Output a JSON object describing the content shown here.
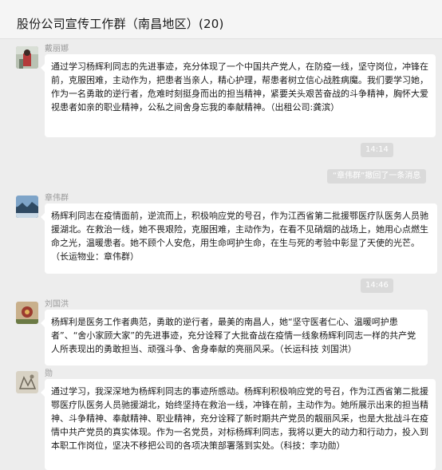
{
  "chat": {
    "title": "股份公司宣传工作群（南昌地区）(20)"
  },
  "messages": [
    {
      "sender": "戴丽娜",
      "avatar_icon": "avatar-photo-icon",
      "text": "通过学习杨辉利同志的先进事迹，充分体现了一个中国共产党人，在防疫一线，坚守岗位，冲锋在前，克服困难，主动作为，把患者当亲人，精心护理，帮患者树立信心战胜病魔。我们要学习她，作为一名勇敢的逆行者，危难时刻挺身而出的担当精神，紧要关头艰苦奋战的斗争精神，胸怀大爱视患者如亲的职业精神，公私之间舍身忘我的奉献精神。（出租公司:龚滨）"
    },
    {
      "sender": "章伟群",
      "avatar_icon": "avatar-landscape-icon",
      "text": "杨辉利同志在疫情面前，逆流而上，积极响应党的号召，作为江西省第二批援鄂医疗队医务人员驰援湖北。在救治一线，她不畏艰险，克服困难，主动作为，在看不见硝烟的战场上，她用心点燃生命之光，温暖患者。她不顾个人安危，用生命呵护生命，在生与死的考验中彰显了天使的光芒。（长运物业：章伟群）"
    },
    {
      "sender": "刘国洪",
      "avatar_icon": "avatar-flower-icon",
      "text": "杨辉利是医务工作者典范，勇敢的逆行者，最美的南昌人，她“坚守医者仁心、温暖呵护患者”、“舍小家顾大家”的先进事迹，充分诠释了大批奋战在疫情一线象杨辉利同志一样的共产党人所表现出的勇敢担当、顽强斗争、舍身奉献的亮丽风采。（长运科技 刘国洪）"
    },
    {
      "sender": "勋",
      "avatar_icon": "avatar-sketch-icon",
      "text": "通过学习，我深深地为杨辉利同志的事迹所感动。杨辉利积极响应党的号召，作为江西省第二批援鄂医疗队医务人员驰援湖北，始终坚持在救治一线，冲锋在前，主动作为。她所展示出来的担当精神、斗争精神、奉献精神、职业精神，充分诠释了新时期共产党员的靓丽风采，也是大批战斗在疫情中共产党员的真实体现。作为一名党员，对标杨辉利同志，我将以更大的动力和行动力，投入到本职工作岗位，坚决不移把公司的各项决策部署落到实处。（科技：李功勋）"
    }
  ],
  "timestamps": [
    "14:14",
    "14:46"
  ],
  "system_notice": "“章伟群”撤回了一条消息"
}
